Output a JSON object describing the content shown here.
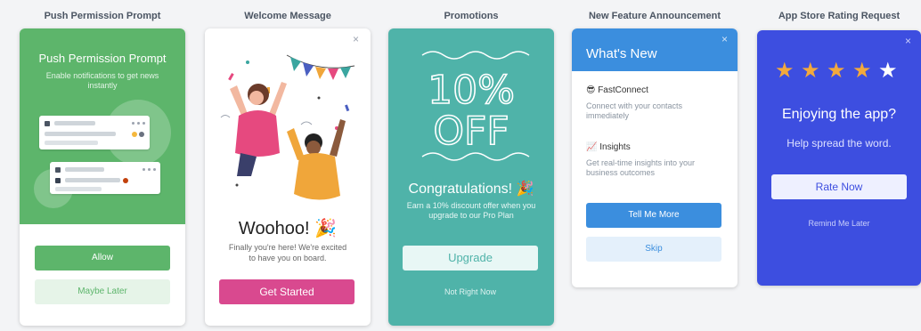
{
  "columns": {
    "push": "Push Permission Prompt",
    "welcome": "Welcome Message",
    "promotions": "Promotions",
    "feature": "New Feature Announcement",
    "rating": "App Store Rating Request"
  },
  "push_card": {
    "title": "Push Permission Prompt",
    "subtitle": "Enable notifications to get news instantly",
    "allow_label": "Allow",
    "later_label": "Maybe Later"
  },
  "welcome_card": {
    "close": "×",
    "title": "Woohoo! 🎉",
    "message": "Finally you're here! We're excited to have you on board.",
    "cta_label": "Get Started"
  },
  "promo_card": {
    "headline_line1": "10%",
    "headline_line2": "OFF",
    "title": "Congratulations! 🎉",
    "message": "Earn a 10% discount offer when you upgrade to our Pro Plan",
    "upgrade_label": "Upgrade",
    "not_now_label": "Not Right Now"
  },
  "feature_card": {
    "close": "×",
    "title": "What's New",
    "features": [
      {
        "title": "😎 FastConnect",
        "desc": "Connect with your contacts immediately"
      },
      {
        "title": "📈 Insights",
        "desc": "Get real-time insights into your business outcomes"
      }
    ],
    "tell_more_label": "Tell Me More",
    "skip_label": "Skip"
  },
  "rating_card": {
    "close": "×",
    "rating": 4,
    "max_rating": 5,
    "title": "Enjoying the app?",
    "subtitle": "Help spread the word.",
    "rate_label": "Rate Now",
    "later_label": "Remind Me Later"
  },
  "colors": {
    "green": "#5db56b",
    "pink": "#d9498f",
    "teal": "#4fb3a9",
    "blue": "#3b8ede",
    "indigo": "#3d4ee0",
    "star": "#f3a93c"
  }
}
